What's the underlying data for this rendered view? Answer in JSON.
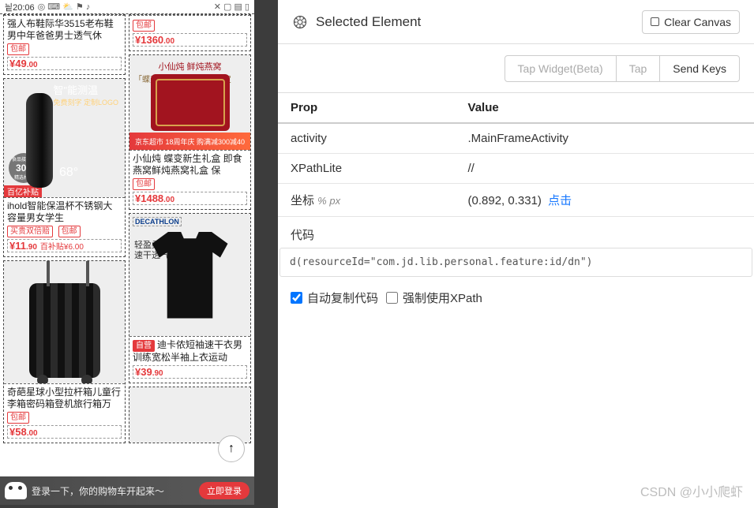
{
  "statusbar": {
    "time": "20:06",
    "icons_left": "◎ ⌨ ⛅ ⚑ ♪",
    "icons_right": "✕ ▢ ▤ ▯"
  },
  "col1": {
    "p0": {
      "title": "强人布鞋际华3515老布鞋男中年爸爸男士透气休",
      "ship": "包邮",
      "price": "¥49",
      "price_dec": ".00"
    },
    "p1": {
      "overlay_title": "智\"能测温",
      "overlay_sub": "免费刻字 定制LOGO",
      "stamp_top": "食品接触用",
      "stamp_big": "304",
      "stamp_bot": "精选材质",
      "temp": "68°",
      "topbadge": "百亿补贴",
      "title_prefix": "ihold智能保温杯不锈钢大容量男女学生",
      "badge2": "买贵双倍赔",
      "ship": "包邮",
      "price": "¥11",
      "price_dec": ".90",
      "sub": "百补贴¥6.00"
    },
    "p2": {
      "title": "奇葩星球小型拉杆箱儿童行李箱密码箱登机旅行箱万",
      "ship": "包邮",
      "price": "¥58",
      "price_dec": ".00"
    }
  },
  "col2": {
    "p0": {
      "ship": "包邮",
      "price": "¥1360",
      "price_dec": ".00"
    },
    "p1": {
      "brand": "小仙炖 鲜炖燕窝",
      "tag": "「蝶变新生」礼盒 春季限定",
      "jd": "京东超市 18周年庆   购满减300减40",
      "title": "小仙炖  蝶变新生礼盒 即食燕窝鲜炖燕窝礼盒 保",
      "ship": "包邮",
      "price": "¥1488",
      "price_dec": ".00"
    },
    "p2": {
      "logo": "DECATHLON",
      "slogan1": "轻盈柔软",
      "slogan2": "速干透气",
      "badge": "自营",
      "title": "迪卡侬短袖速干衣男训练宽松半袖上衣运动",
      "price": "¥39",
      "price_dec": ".90"
    }
  },
  "loginbar": {
    "text": "登录一下，你的购物车开起来～",
    "btn": "立即登录"
  },
  "fab": "↑",
  "panel": {
    "title": "Selected Element",
    "clear": "Clear Canvas",
    "btns": {
      "tapw": "Tap Widget(Beta)",
      "tap": "Tap",
      "send": "Send Keys"
    },
    "table": {
      "h1": "Prop",
      "h2": "Value",
      "r1k": "activity",
      "r1v": ".MainFrameActivity",
      "r2k": "XPathLite",
      "r2v": "//",
      "r3k": "坐标 ",
      "r3unit": "% px",
      "r3v": "(0.892, 0.331) ",
      "r3link": "点击"
    },
    "code_label": "代码",
    "code": "d(resourceId=\"com.jd.lib.personal.feature:id/dn\")",
    "cb1": "自动复制代码",
    "cb2": "强制使用XPath"
  },
  "watermark": "CSDN @小小爬虾"
}
